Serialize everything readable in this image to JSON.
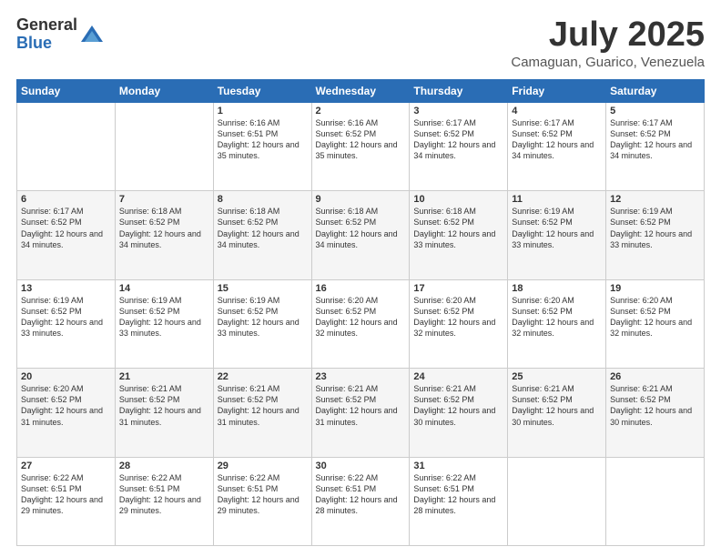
{
  "logo": {
    "general": "General",
    "blue": "Blue"
  },
  "title": "July 2025",
  "location": "Camaguan, Guarico, Venezuela",
  "days_of_week": [
    "Sunday",
    "Monday",
    "Tuesday",
    "Wednesday",
    "Thursday",
    "Friday",
    "Saturday"
  ],
  "weeks": [
    [
      {
        "day": "",
        "info": ""
      },
      {
        "day": "",
        "info": ""
      },
      {
        "day": "1",
        "info": "Sunrise: 6:16 AM\nSunset: 6:51 PM\nDaylight: 12 hours and 35 minutes."
      },
      {
        "day": "2",
        "info": "Sunrise: 6:16 AM\nSunset: 6:52 PM\nDaylight: 12 hours and 35 minutes."
      },
      {
        "day": "3",
        "info": "Sunrise: 6:17 AM\nSunset: 6:52 PM\nDaylight: 12 hours and 34 minutes."
      },
      {
        "day": "4",
        "info": "Sunrise: 6:17 AM\nSunset: 6:52 PM\nDaylight: 12 hours and 34 minutes."
      },
      {
        "day": "5",
        "info": "Sunrise: 6:17 AM\nSunset: 6:52 PM\nDaylight: 12 hours and 34 minutes."
      }
    ],
    [
      {
        "day": "6",
        "info": "Sunrise: 6:17 AM\nSunset: 6:52 PM\nDaylight: 12 hours and 34 minutes."
      },
      {
        "day": "7",
        "info": "Sunrise: 6:18 AM\nSunset: 6:52 PM\nDaylight: 12 hours and 34 minutes."
      },
      {
        "day": "8",
        "info": "Sunrise: 6:18 AM\nSunset: 6:52 PM\nDaylight: 12 hours and 34 minutes."
      },
      {
        "day": "9",
        "info": "Sunrise: 6:18 AM\nSunset: 6:52 PM\nDaylight: 12 hours and 34 minutes."
      },
      {
        "day": "10",
        "info": "Sunrise: 6:18 AM\nSunset: 6:52 PM\nDaylight: 12 hours and 33 minutes."
      },
      {
        "day": "11",
        "info": "Sunrise: 6:19 AM\nSunset: 6:52 PM\nDaylight: 12 hours and 33 minutes."
      },
      {
        "day": "12",
        "info": "Sunrise: 6:19 AM\nSunset: 6:52 PM\nDaylight: 12 hours and 33 minutes."
      }
    ],
    [
      {
        "day": "13",
        "info": "Sunrise: 6:19 AM\nSunset: 6:52 PM\nDaylight: 12 hours and 33 minutes."
      },
      {
        "day": "14",
        "info": "Sunrise: 6:19 AM\nSunset: 6:52 PM\nDaylight: 12 hours and 33 minutes."
      },
      {
        "day": "15",
        "info": "Sunrise: 6:19 AM\nSunset: 6:52 PM\nDaylight: 12 hours and 33 minutes."
      },
      {
        "day": "16",
        "info": "Sunrise: 6:20 AM\nSunset: 6:52 PM\nDaylight: 12 hours and 32 minutes."
      },
      {
        "day": "17",
        "info": "Sunrise: 6:20 AM\nSunset: 6:52 PM\nDaylight: 12 hours and 32 minutes."
      },
      {
        "day": "18",
        "info": "Sunrise: 6:20 AM\nSunset: 6:52 PM\nDaylight: 12 hours and 32 minutes."
      },
      {
        "day": "19",
        "info": "Sunrise: 6:20 AM\nSunset: 6:52 PM\nDaylight: 12 hours and 32 minutes."
      }
    ],
    [
      {
        "day": "20",
        "info": "Sunrise: 6:20 AM\nSunset: 6:52 PM\nDaylight: 12 hours and 31 minutes."
      },
      {
        "day": "21",
        "info": "Sunrise: 6:21 AM\nSunset: 6:52 PM\nDaylight: 12 hours and 31 minutes."
      },
      {
        "day": "22",
        "info": "Sunrise: 6:21 AM\nSunset: 6:52 PM\nDaylight: 12 hours and 31 minutes."
      },
      {
        "day": "23",
        "info": "Sunrise: 6:21 AM\nSunset: 6:52 PM\nDaylight: 12 hours and 31 minutes."
      },
      {
        "day": "24",
        "info": "Sunrise: 6:21 AM\nSunset: 6:52 PM\nDaylight: 12 hours and 30 minutes."
      },
      {
        "day": "25",
        "info": "Sunrise: 6:21 AM\nSunset: 6:52 PM\nDaylight: 12 hours and 30 minutes."
      },
      {
        "day": "26",
        "info": "Sunrise: 6:21 AM\nSunset: 6:52 PM\nDaylight: 12 hours and 30 minutes."
      }
    ],
    [
      {
        "day": "27",
        "info": "Sunrise: 6:22 AM\nSunset: 6:51 PM\nDaylight: 12 hours and 29 minutes."
      },
      {
        "day": "28",
        "info": "Sunrise: 6:22 AM\nSunset: 6:51 PM\nDaylight: 12 hours and 29 minutes."
      },
      {
        "day": "29",
        "info": "Sunrise: 6:22 AM\nSunset: 6:51 PM\nDaylight: 12 hours and 29 minutes."
      },
      {
        "day": "30",
        "info": "Sunrise: 6:22 AM\nSunset: 6:51 PM\nDaylight: 12 hours and 28 minutes."
      },
      {
        "day": "31",
        "info": "Sunrise: 6:22 AM\nSunset: 6:51 PM\nDaylight: 12 hours and 28 minutes."
      },
      {
        "day": "",
        "info": ""
      },
      {
        "day": "",
        "info": ""
      }
    ]
  ]
}
